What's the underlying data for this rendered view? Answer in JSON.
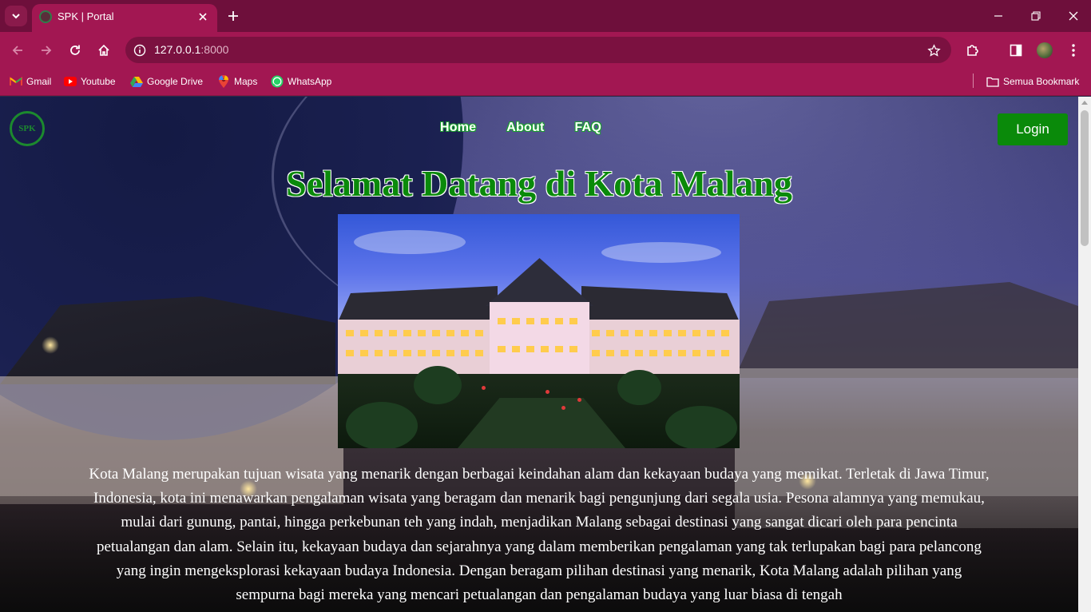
{
  "browser": {
    "tab_title": "SPK | Portal",
    "url_host": "127.0.0.1",
    "url_port": ":8000",
    "bookmarks": [
      {
        "label": "Gmail",
        "icon": "gmail-icon"
      },
      {
        "label": "Youtube",
        "icon": "youtube-icon"
      },
      {
        "label": "Google Drive",
        "icon": "google-drive-icon"
      },
      {
        "label": "Maps",
        "icon": "maps-icon"
      },
      {
        "label": "WhatsApp",
        "icon": "whatsapp-icon"
      }
    ],
    "all_bookmarks_label": "Semua Bookmark",
    "colors": {
      "tabbar": "#6e0f3b",
      "toolbar": "#a21752",
      "omnibox": "#7b1140"
    }
  },
  "site": {
    "logo_text": "SPK",
    "nav": {
      "home": "Home",
      "about": "About",
      "faq": "FAQ"
    },
    "login_label": "Login",
    "hero_title": "Selamat Datang di Kota Malang",
    "hero_text": "Kota Malang merupakan tujuan wisata yang menarik dengan berbagai keindahan alam dan kekayaan budaya yang memikat. Terletak di Jawa Timur, Indonesia, kota ini menawarkan pengalaman wisata yang beragam dan menarik bagi pengunjung dari segala usia. Pesona alamnya yang memukau, mulai dari gunung, pantai, hingga perkebunan teh yang indah, menjadikan Malang sebagai destinasi yang sangat dicari oleh para pencinta petualangan dan alam. Selain itu, kekayaan budaya dan sejarahnya yang dalam memberikan pengalaman yang tak terlupakan bagi para pelancong yang ingin mengeksplorasi kekayaan budaya Indonesia. Dengan beragam pilihan destinasi yang menarik, Kota Malang adalah pilihan yang sempurna bagi mereka yang mencari petualangan dan pengalaman budaya yang luar biasa di tengah",
    "colors": {
      "accent_green": "#0a8a0a",
      "nav_outline": "#1aa12e"
    }
  }
}
